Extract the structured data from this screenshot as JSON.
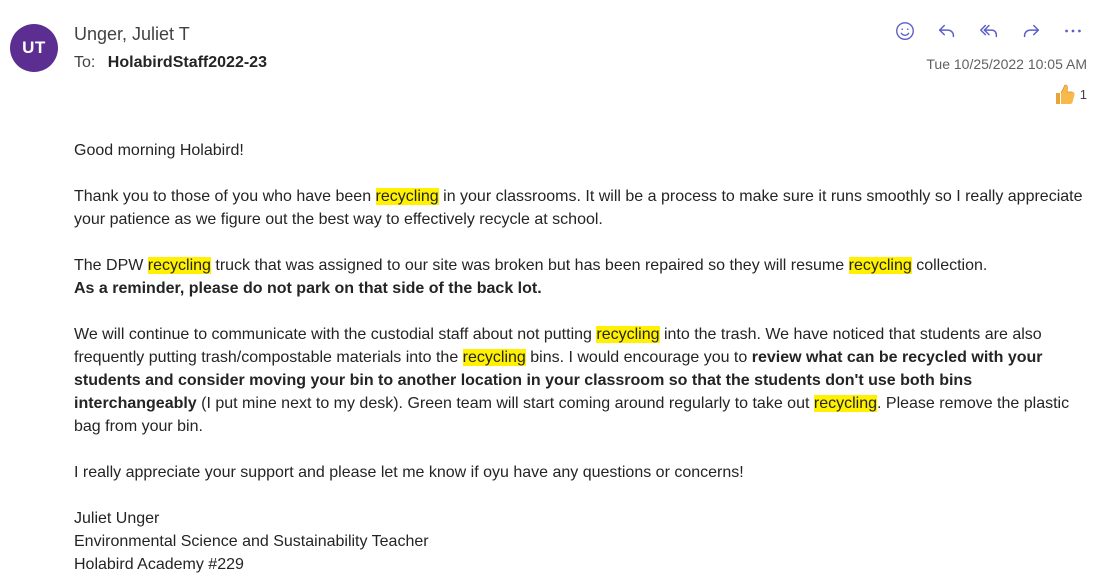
{
  "sender": {
    "initials": "UT",
    "name": "Unger, Juliet T",
    "avatar_color": "#5c2e91"
  },
  "to": {
    "label": "To:",
    "recipient": "HolabirdStaff2022-23"
  },
  "timestamp": "Tue 10/25/2022 10:05 AM",
  "actions": [
    "emoji-icon",
    "reply-icon",
    "reply-all-icon",
    "forward-icon",
    "more-icon"
  ],
  "reaction": {
    "icon": "thumbs-up-icon",
    "count": "1"
  },
  "highlight_color": "#fff100",
  "body": {
    "greeting": "Good morning Holabird!",
    "p1": {
      "s1": "Thank you to those of you who have been ",
      "h1": "recycling",
      "s2": " in your classrooms. It will be a process to make sure it runs smoothly so I really appreciate your patience as we figure out the best way to effectively recycle at school."
    },
    "p2": {
      "s1": "The DPW ",
      "h1": "recycling",
      "s2": " truck that was assigned to our site was broken but has been repaired so they will resume ",
      "h2": "recycling",
      "s3": " collection.",
      "bold": "As a reminder, please do not park on that side of the back lot."
    },
    "p3": {
      "s1": "We will continue to communicate with the custodial staff about not putting ",
      "h1": "recycling",
      "s2": " into the trash. We have noticed that students are also frequently putting trash/compostable materials into the ",
      "h2": "recycling",
      "s3": " bins. I would encourage you to ",
      "bold": "review what can be recycled with your students and consider moving your bin to another location in your classroom so that the students don't use both bins interchangeably",
      "s4": " (I put mine next to my desk). Green team will start coming around regularly to take out ",
      "h3": "recycling",
      "s5": ". Please remove the plastic bag from your bin."
    },
    "p4": "I really appreciate your support and please let me know if oyu have any questions or concerns!",
    "signature": {
      "name": "Juliet Unger",
      "title": "Environmental Science and Sustainability Teacher",
      "school": "Holabird Academy #229"
    }
  }
}
